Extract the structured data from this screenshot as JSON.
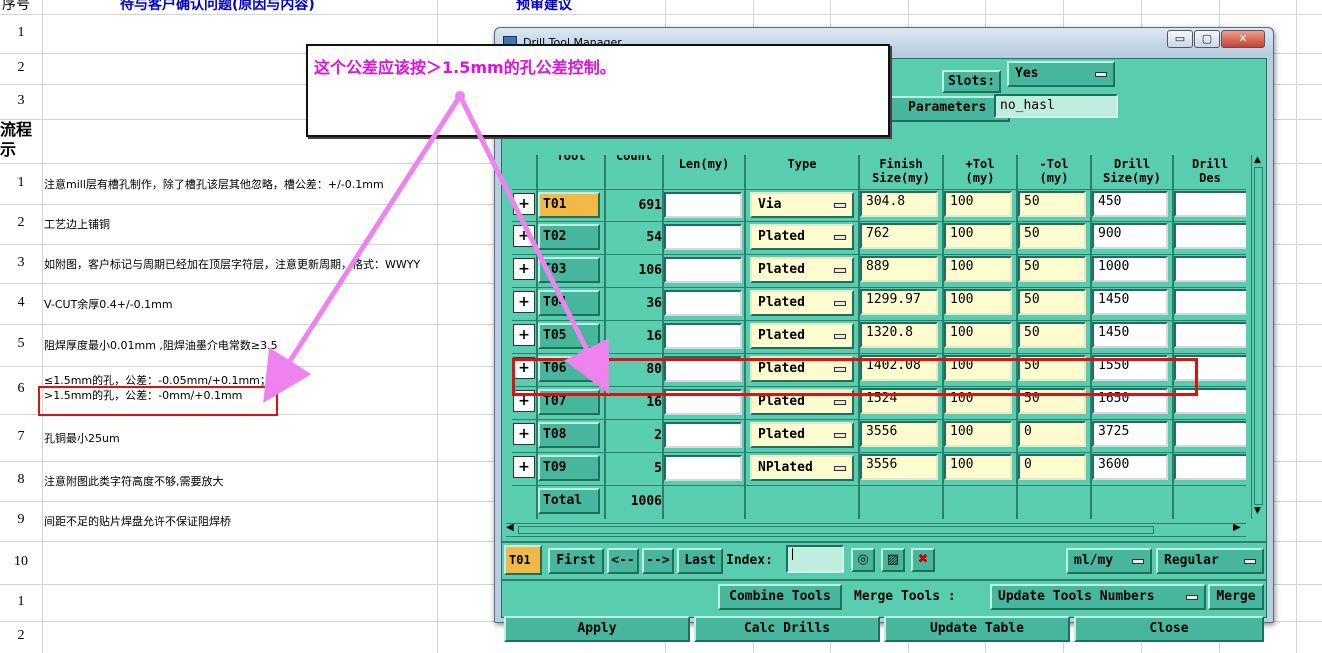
{
  "spreadsheet": {
    "headers": {
      "seq": "序号",
      "question": "待与客户确认问题(原因与内容)",
      "suggest": "预审建议"
    },
    "section_label": "流程\n示",
    "rows": [
      {
        "n": "1",
        "text": ""
      },
      {
        "n": "2",
        "text": ""
      },
      {
        "n": "3",
        "text": ""
      },
      {
        "n": "1",
        "text": "注意mill层有槽孔制作，除了槽孔该层其他忽略，槽公差：+/-0.1mm"
      },
      {
        "n": "2",
        "text": "工艺边上铺铜"
      },
      {
        "n": "3",
        "text": "如附图，客户标记与周期已经加在顶层字符层，注意更新周期，格式：WWYY"
      },
      {
        "n": "4",
        "text": "V-CUT余厚0.4+/-0.1mm"
      },
      {
        "n": "5",
        "text": "阻焊厚度最小0.01mm ,阻焊油墨介电常数≥3.5"
      },
      {
        "n": "6",
        "text": "≤1.5mm的孔，公差：-0.05mm/+0.1mm；",
        "text2": ">1.5mm的孔，公差：-0mm/+0.1mm"
      },
      {
        "n": "7",
        "text": "孔铜最小25um"
      },
      {
        "n": "8",
        "text": "注意附图此类字符高度不够,需要放大"
      },
      {
        "n": "9",
        "text": "间距不足的贴片焊盘允许不保证阻焊桥"
      },
      {
        "n": "10",
        "text": ""
      },
      {
        "n": "1",
        "text": ""
      },
      {
        "n": "2",
        "text": ""
      }
    ]
  },
  "callout": {
    "text": "这个公差应该按＞1.5mm的孔公差控制。"
  },
  "dialog": {
    "title": "Drill Tool Manager",
    "titlebar_buttons": [
      "▭",
      "▢",
      "✕"
    ],
    "slots_label": "Slots:",
    "slots_value": "Yes",
    "parameters_label": "Parameters :",
    "parameters_value": "no_hasl",
    "columns": [
      "",
      "Tool",
      "Count",
      "Len(my)",
      "Type",
      "Finish\nSize(my)",
      "+Tol\n(my)",
      "-Tol\n(my)",
      "Drill\nSize(my)",
      "Drill\nDes"
    ],
    "tools": [
      {
        "tool": "T01",
        "count": "691",
        "len": "",
        "type": "Via",
        "finish": "304.8",
        "ptol": "100",
        "ntol": "50",
        "drill": "450",
        "des": ""
      },
      {
        "tool": "T02",
        "count": "54",
        "len": "",
        "type": "Plated",
        "finish": "762",
        "ptol": "100",
        "ntol": "50",
        "drill": "900",
        "des": ""
      },
      {
        "tool": "T03",
        "count": "106",
        "len": "",
        "type": "Plated",
        "finish": "889",
        "ptol": "100",
        "ntol": "50",
        "drill": "1000",
        "des": ""
      },
      {
        "tool": "T04",
        "count": "36",
        "len": "",
        "type": "Plated",
        "finish": "1299.97",
        "ptol": "100",
        "ntol": "50",
        "drill": "1450",
        "des": ""
      },
      {
        "tool": "T05",
        "count": "16",
        "len": "",
        "type": "Plated",
        "finish": "1320.8",
        "ptol": "100",
        "ntol": "50",
        "drill": "1450",
        "des": ""
      },
      {
        "tool": "T06",
        "count": "80",
        "len": "",
        "type": "Plated",
        "finish": "1402.08",
        "ptol": "100",
        "ntol": "50",
        "drill": "1550",
        "des": ""
      },
      {
        "tool": "T07",
        "count": "16",
        "len": "",
        "type": "Plated",
        "finish": "1524",
        "ptol": "100",
        "ntol": "50",
        "drill": "1650",
        "des": ""
      },
      {
        "tool": "T08",
        "count": "2",
        "len": "",
        "type": "Plated",
        "finish": "3556",
        "ptol": "100",
        "ntol": "0",
        "drill": "3725",
        "des": ""
      },
      {
        "tool": "T09",
        "count": "5",
        "len": "",
        "type": "NPlated",
        "finish": "3556",
        "ptol": "100",
        "ntol": "0",
        "drill": "3600",
        "des": ""
      }
    ],
    "total_label": "Total",
    "total_count": "1006",
    "current_tool": "T01",
    "nav": {
      "first": "First",
      "prev": "<--",
      "next": "-->",
      "last": "Last",
      "index_label": "Index:",
      "index_value": ""
    },
    "units": "ml/my",
    "mode": "Regular",
    "combine_tools": "Combine Tools",
    "merge_tools_label": "Merge Tools :",
    "merge_option": "Update Tools Numbers",
    "merge": "Merge",
    "apply": "Apply",
    "calc_drills": "Calc Drills",
    "update_table": "Update Table",
    "close": "Close"
  },
  "colors": {
    "highlight": "#e01010",
    "callout_text": "#e010e0",
    "dialog_bg": "#58cdb0",
    "selected_tool": "#f2b848",
    "arrow": "#ee82ee"
  }
}
